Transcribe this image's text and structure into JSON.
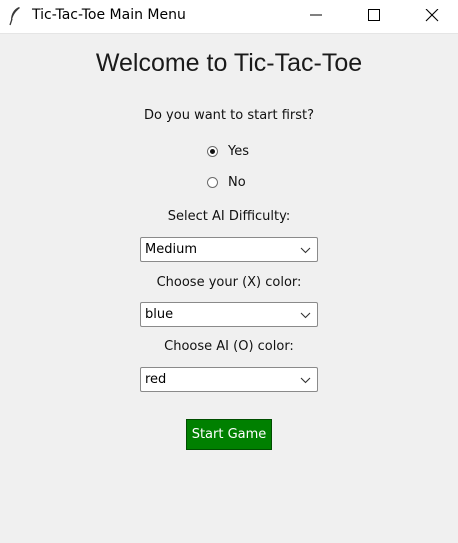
{
  "window": {
    "title": "Tic-Tac-Toe Main Menu",
    "icon": "feather-icon"
  },
  "main": {
    "heading": "Welcome to Tic-Tac-Toe",
    "start_first": {
      "question": "Do you want to start first?",
      "options": [
        {
          "label": "Yes",
          "selected": true
        },
        {
          "label": "No",
          "selected": false
        }
      ]
    },
    "difficulty": {
      "label": "Select AI Difficulty:",
      "value": "Medium"
    },
    "player_color": {
      "label": "Choose your (X) color:",
      "value": "blue"
    },
    "ai_color": {
      "label": "Choose AI (O) color:",
      "value": "red"
    },
    "start_button": {
      "label": "Start Game",
      "color": "#008000"
    }
  }
}
